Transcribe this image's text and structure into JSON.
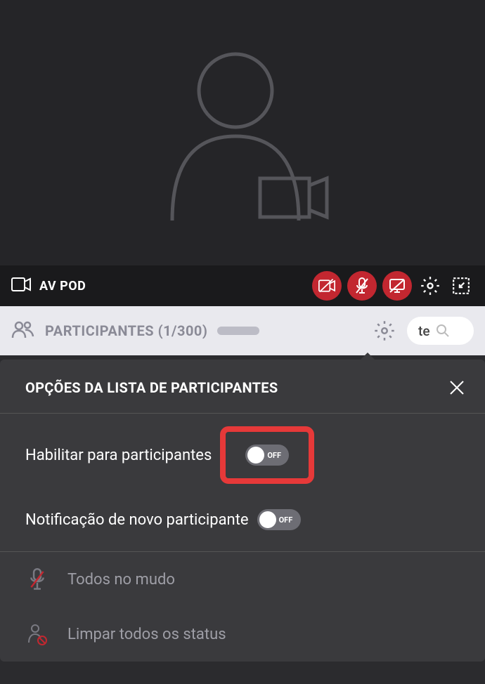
{
  "toolbar": {
    "title": "AV POD"
  },
  "participants": {
    "label": "PARTICIPANTES (1/300)",
    "search_value": "te"
  },
  "popover": {
    "title": "OPÇÕES DA LISTA DE PARTICIPANTES",
    "options": {
      "enable_for_participants": {
        "label": "Habilitar para participantes",
        "state": "OFF"
      },
      "new_participant_notification": {
        "label": "Notificação de novo participante",
        "state": "OFF"
      }
    },
    "actions": {
      "mute_all": "Todos no mudo",
      "clear_status": "Limpar todos os status"
    }
  }
}
